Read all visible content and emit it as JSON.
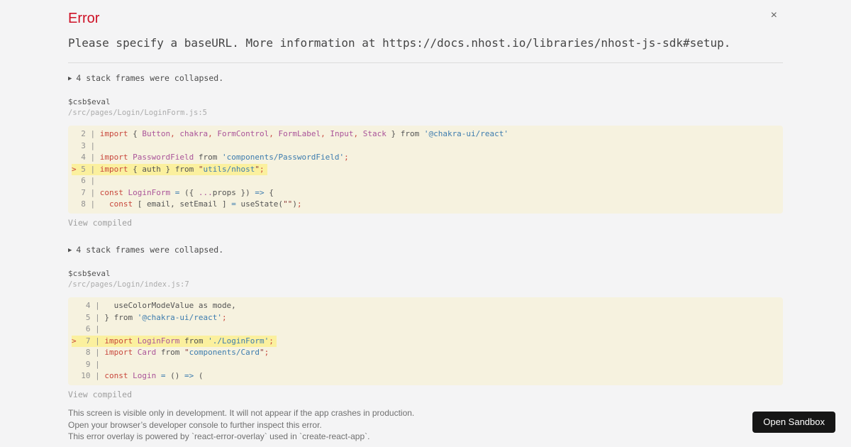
{
  "colors": {
    "page_bg": "#f4f4f5",
    "title_red": "#ce1126",
    "code_bg": "#f6f2df",
    "code_highlight": "#fbf09e",
    "keyword_red": "#c8473c",
    "identifier_purple": "#aa5499",
    "string_blue": "#3d7cae",
    "quote_darkred": "#8b3a3a",
    "button_bg": "#161616",
    "button_fg": "#ffffff"
  },
  "header": {
    "title": "Error",
    "close_label": "×"
  },
  "message": "Please specify a baseURL. More information at https://docs.nhost.io/libraries/nhost-js-sdk#setup.",
  "frames": [
    {
      "collapse_arrow": "▶",
      "collapsed_text": "4 stack frames were collapsed.",
      "function_name": "$csb$eval",
      "location": "/src/pages/Login/LoginForm.js:5",
      "view_compiled": "View compiled",
      "code": [
        {
          "mark": " ",
          "gutter": " 2 | ",
          "hl": false,
          "tokens": [
            [
              "r",
              "import"
            ],
            [
              "p",
              " { "
            ],
            [
              "u",
              "Button"
            ],
            [
              "r",
              ","
            ],
            [
              "p",
              " "
            ],
            [
              "u",
              "chakra"
            ],
            [
              "r",
              ","
            ],
            [
              "p",
              " "
            ],
            [
              "u",
              "FormControl"
            ],
            [
              "r",
              ","
            ],
            [
              "p",
              " "
            ],
            [
              "u",
              "FormLabel"
            ],
            [
              "r",
              ","
            ],
            [
              "p",
              " "
            ],
            [
              "u",
              "Input"
            ],
            [
              "r",
              ","
            ],
            [
              "p",
              " "
            ],
            [
              "u",
              "Stack"
            ],
            [
              "p",
              " } from "
            ],
            [
              "b",
              "'@chakra-ui/react'"
            ]
          ]
        },
        {
          "mark": " ",
          "gutter": " 3 | ",
          "hl": false,
          "tokens": []
        },
        {
          "mark": " ",
          "gutter": " 4 | ",
          "hl": false,
          "tokens": [
            [
              "r",
              "import"
            ],
            [
              "p",
              " "
            ],
            [
              "u",
              "PasswordField"
            ],
            [
              "p",
              " from "
            ],
            [
              "b",
              "'components/PasswordField'"
            ],
            [
              "r",
              ";"
            ]
          ]
        },
        {
          "mark": ">",
          "gutter": " 5 | ",
          "hl": true,
          "tokens": [
            [
              "r",
              "import"
            ],
            [
              "p",
              " { auth } from "
            ],
            [
              "q",
              "\""
            ],
            [
              "b",
              "utils/nhost"
            ],
            [
              "q",
              "\""
            ],
            [
              "r",
              ";"
            ]
          ]
        },
        {
          "mark": " ",
          "gutter": " 6 | ",
          "hl": false,
          "tokens": []
        },
        {
          "mark": " ",
          "gutter": " 7 | ",
          "hl": false,
          "tokens": [
            [
              "r",
              "const"
            ],
            [
              "p",
              " "
            ],
            [
              "u",
              "LoginForm"
            ],
            [
              "p",
              " "
            ],
            [
              "b",
              "="
            ],
            [
              "p",
              " ({ "
            ],
            [
              "u",
              "..."
            ],
            [
              "p",
              "props }) "
            ],
            [
              "b",
              "=>"
            ],
            [
              "p",
              " {"
            ]
          ]
        },
        {
          "mark": " ",
          "gutter": " 8 | ",
          "hl": false,
          "tokens": [
            [
              "p",
              "  "
            ],
            [
              "r",
              "const"
            ],
            [
              "p",
              " [ email, setEmail ] "
            ],
            [
              "b",
              "="
            ],
            [
              "p",
              " useState("
            ],
            [
              "q",
              "\"\""
            ],
            [
              "p",
              ")"
            ],
            [
              "r",
              ";"
            ]
          ]
        }
      ]
    },
    {
      "collapse_arrow": "▶",
      "collapsed_text": "4 stack frames were collapsed.",
      "function_name": "$csb$eval",
      "location": "/src/pages/Login/index.js:7",
      "view_compiled": "View compiled",
      "code": [
        {
          "mark": " ",
          "gutter": "  4 | ",
          "hl": false,
          "tokens": [
            [
              "p",
              "  useColorModeValue as mode,"
            ]
          ]
        },
        {
          "mark": " ",
          "gutter": "  5 | ",
          "hl": false,
          "tokens": [
            [
              "p",
              "} from "
            ],
            [
              "b",
              "'@chakra-ui/react'"
            ],
            [
              "r",
              ";"
            ]
          ]
        },
        {
          "mark": " ",
          "gutter": "  6 | ",
          "hl": false,
          "tokens": []
        },
        {
          "mark": ">",
          "gutter": "  7 | ",
          "hl": true,
          "tokens": [
            [
              "r",
              "import"
            ],
            [
              "p",
              " "
            ],
            [
              "u",
              "LoginForm"
            ],
            [
              "p",
              " from "
            ],
            [
              "b",
              "'./LoginForm'"
            ],
            [
              "r",
              ";"
            ]
          ]
        },
        {
          "mark": " ",
          "gutter": "  8 | ",
          "hl": false,
          "tokens": [
            [
              "r",
              "import"
            ],
            [
              "p",
              " "
            ],
            [
              "u",
              "Card"
            ],
            [
              "p",
              " from "
            ],
            [
              "q",
              "\""
            ],
            [
              "b",
              "components/Card"
            ],
            [
              "q",
              "\""
            ],
            [
              "r",
              ";"
            ]
          ]
        },
        {
          "mark": " ",
          "gutter": "  9 | ",
          "hl": false,
          "tokens": []
        },
        {
          "mark": " ",
          "gutter": " 10 | ",
          "hl": false,
          "tokens": [
            [
              "r",
              "const"
            ],
            [
              "p",
              " "
            ],
            [
              "u",
              "Login"
            ],
            [
              "p",
              " "
            ],
            [
              "b",
              "="
            ],
            [
              "p",
              " () "
            ],
            [
              "b",
              "=>"
            ],
            [
              "p",
              " ("
            ]
          ]
        }
      ]
    }
  ],
  "footer": {
    "lines": [
      "This screen is visible only in development. It will not appear if the app crashes in production.",
      "Open your browser’s developer console to further inspect this error.",
      "This error overlay is powered by `react-error-overlay` used in `create-react-app`."
    ],
    "button_label": "Open Sandbox"
  }
}
